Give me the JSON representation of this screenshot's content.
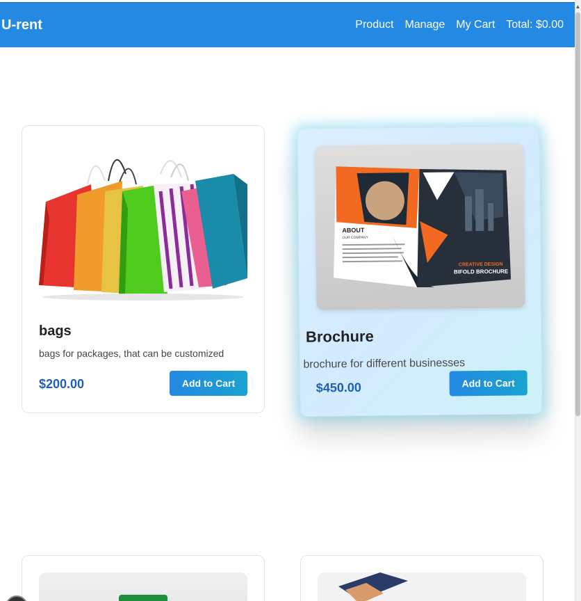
{
  "nav": {
    "brand": "U-rent",
    "links": [
      "Product",
      "Manage",
      "My Cart"
    ],
    "total": "Total: $0.00"
  },
  "products": [
    {
      "name": "bags",
      "description": "bags for packages, that can be customized",
      "price": "$200.00",
      "button": "Add to Cart"
    },
    {
      "name": "Brochure",
      "description": "brochure for different businesses",
      "price": "$450.00",
      "button": "Add to Cart",
      "image_text": {
        "top_left": "ABOUT",
        "top_left_sub": "OUR COMPANY",
        "bottom_right": "CREATIVE DESIGN",
        "bottom_right_sub": "BIFOLD BROCHURE"
      }
    }
  ],
  "colors": {
    "navbar": "#2389e3",
    "price": "#1e5fb8",
    "button": "#2388e2"
  }
}
